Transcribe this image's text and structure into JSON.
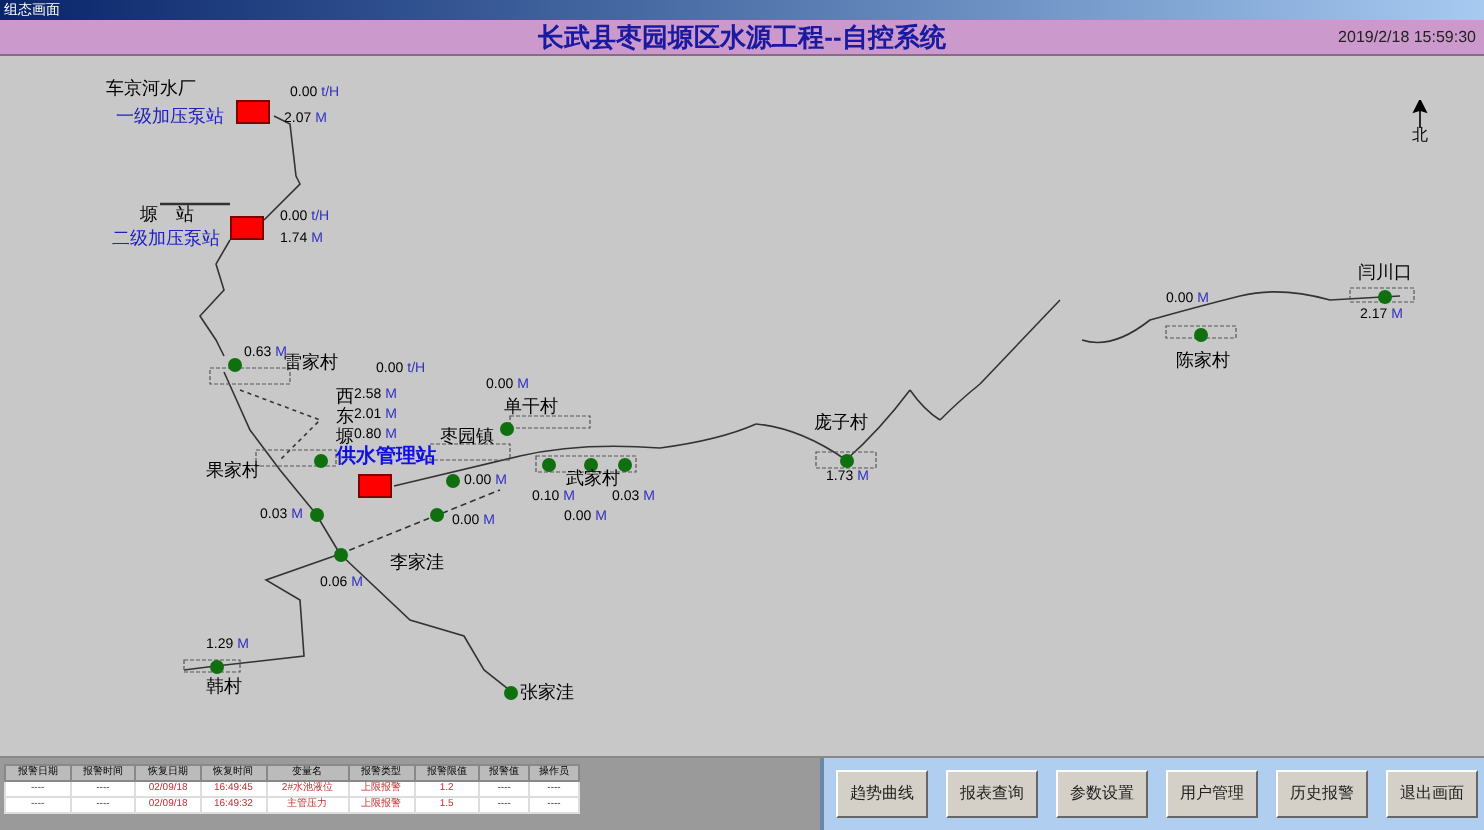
{
  "window": {
    "title": "组态画面"
  },
  "header": {
    "title": "长武县枣园塬区水源工程--自控系统",
    "datetime": "2019/2/18 15:59:30"
  },
  "map": {
    "compass": "北",
    "labels": [
      {
        "kind": "name",
        "text": "车京河水厂"
      },
      {
        "kind": "station",
        "text": "一级加压泵站"
      },
      {
        "kind": "reading",
        "text": "0.00",
        "unit": "t/H"
      },
      {
        "kind": "reading",
        "text": "2.07",
        "unit": "M"
      },
      {
        "kind": "name",
        "text": "塬　站"
      },
      {
        "kind": "station",
        "text": "二级加压泵站"
      },
      {
        "kind": "reading",
        "text": "0.00",
        "unit": "t/H"
      },
      {
        "kind": "reading",
        "text": "1.74",
        "unit": "M"
      },
      {
        "kind": "reading",
        "text": "0.63",
        "unit": "M"
      },
      {
        "kind": "name",
        "text": "雷家村"
      },
      {
        "kind": "reading",
        "text": "0.00",
        "unit": "t/H"
      },
      {
        "kind": "name",
        "text": "西"
      },
      {
        "kind": "reading",
        "text": "2.58",
        "unit": "M"
      },
      {
        "kind": "name",
        "text": "东"
      },
      {
        "kind": "reading",
        "text": "2.01",
        "unit": "M"
      },
      {
        "kind": "name",
        "text": "塬"
      },
      {
        "kind": "reading",
        "text": "0.80",
        "unit": "M"
      },
      {
        "kind": "reading",
        "text": "0.00",
        "unit": "M"
      },
      {
        "kind": "name",
        "text": "单干村"
      },
      {
        "kind": "name",
        "text": "枣园镇"
      },
      {
        "kind": "manager",
        "text": "供水管理站"
      },
      {
        "kind": "name",
        "text": "果家村"
      },
      {
        "kind": "name",
        "text": "武家村"
      },
      {
        "kind": "reading",
        "text": "0.10",
        "unit": "M"
      },
      {
        "kind": "reading",
        "text": "0.03",
        "unit": "M"
      },
      {
        "kind": "reading",
        "text": "0.00",
        "unit": "M"
      },
      {
        "kind": "reading",
        "text": "0.00",
        "unit": "M"
      },
      {
        "kind": "reading",
        "text": "0.03",
        "unit": "M"
      },
      {
        "kind": "reading",
        "text": "0.00",
        "unit": "M"
      },
      {
        "kind": "name",
        "text": "李家洼"
      },
      {
        "kind": "reading",
        "text": "0.06",
        "unit": "M"
      },
      {
        "kind": "reading",
        "text": "1.29",
        "unit": "M"
      },
      {
        "kind": "name",
        "text": "韩村"
      },
      {
        "kind": "name",
        "text": "张家洼"
      },
      {
        "kind": "name",
        "text": "庞子村"
      },
      {
        "kind": "reading",
        "text": "1.73",
        "unit": "M"
      },
      {
        "kind": "reading",
        "text": "0.00",
        "unit": "M"
      },
      {
        "kind": "name",
        "text": "陈家村"
      },
      {
        "kind": "name",
        "text": "闫川口"
      },
      {
        "kind": "reading",
        "text": "2.17",
        "unit": "M"
      }
    ]
  },
  "alarm_table": {
    "columns": [
      "报警日期",
      "报警时间",
      "恢复日期",
      "恢复时间",
      "变量名",
      "报警类型",
      "报警限值",
      "报警值",
      "操作员"
    ],
    "rows": [
      [
        "----",
        "----",
        "02/09/18",
        "16:49:45",
        "2#水池液位",
        "上限报警",
        "1.2",
        "----",
        "----"
      ],
      [
        "----",
        "----",
        "02/09/18",
        "16:49:32",
        "主管压力",
        "上限报警",
        "1.5",
        "----",
        "----"
      ]
    ]
  },
  "buttons": [
    "趋势曲线",
    "报表查询",
    "参数设置",
    "用户管理",
    "历史报警",
    "退出画面"
  ]
}
